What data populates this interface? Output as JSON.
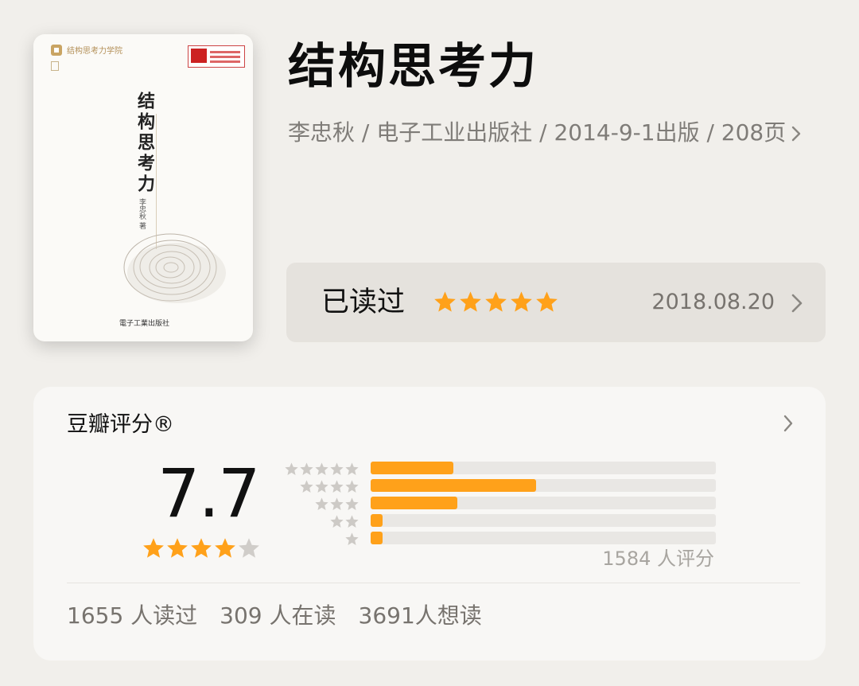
{
  "book": {
    "title": "结构思考力",
    "meta": "李忠秋 / 电子工业出版社 / 2014-9-1出版 / 208页",
    "cover": {
      "title": "结构思考力",
      "author": "李忠秋 著",
      "publisher": "電子工業出版社",
      "logo_text": "结构思考力学院"
    }
  },
  "reading_status": {
    "label": "已读过",
    "rating": 5,
    "date": "2018.08.20"
  },
  "douban_rating": {
    "title": "豆瓣评分®",
    "score": "7.7",
    "star_rating": 4,
    "distribution": [
      {
        "stars": 5,
        "fraction": 0.24
      },
      {
        "stars": 4,
        "fraction": 0.48
      },
      {
        "stars": 3,
        "fraction": 0.25
      },
      {
        "stars": 2,
        "fraction": 0.035
      },
      {
        "stars": 1,
        "fraction": 0.035
      }
    ],
    "rater_count": "1584 人评分",
    "readers": {
      "read": "1655 人读过",
      "reading": "309 人在读",
      "want": "3691人想读"
    }
  },
  "colors": {
    "accent": "#ffa11a",
    "star_empty": "#c9c6c2",
    "background": "#f1efeb"
  }
}
